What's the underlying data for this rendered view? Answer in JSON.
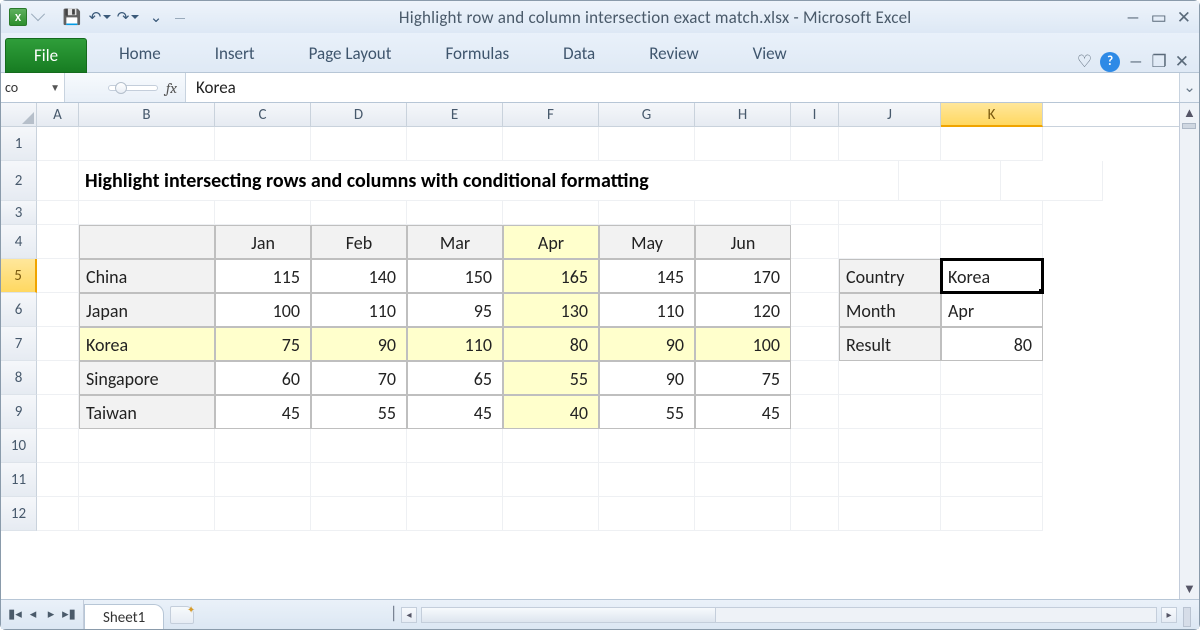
{
  "window": {
    "title": "Highlight row and column intersection exact match.xlsx - Microsoft Excel"
  },
  "ribbon": {
    "file": "File",
    "tabs": [
      "Home",
      "Insert",
      "Page Layout",
      "Formulas",
      "Data",
      "Review",
      "View"
    ]
  },
  "name_box": "co",
  "formula": "Korea",
  "columns": [
    "A",
    "B",
    "C",
    "D",
    "E",
    "F",
    "G",
    "H",
    "I",
    "J",
    "K"
  ],
  "rows_shown": [
    "1",
    "2",
    "3",
    "4",
    "5",
    "6",
    "7",
    "8",
    "9",
    "10",
    "11",
    "12"
  ],
  "selected_col": "K",
  "selected_row": "5",
  "heading": "Highlight intersecting rows and columns with conditional formatting",
  "chart_data": {
    "type": "table",
    "title": "Highlight intersecting rows and columns with conditional formatting",
    "columns": [
      "Jan",
      "Feb",
      "Mar",
      "Apr",
      "May",
      "Jun"
    ],
    "rows": [
      "China",
      "Japan",
      "Korea",
      "Singapore",
      "Taiwan"
    ],
    "values": [
      [
        115,
        140,
        150,
        165,
        145,
        170
      ],
      [
        100,
        110,
        95,
        130,
        110,
        120
      ],
      [
        75,
        90,
        110,
        80,
        90,
        100
      ],
      [
        60,
        70,
        65,
        55,
        90,
        75
      ],
      [
        45,
        55,
        45,
        40,
        55,
        45
      ]
    ],
    "highlight_row": "Korea",
    "highlight_col": "Apr",
    "lookup": {
      "labels": {
        "country": "Country",
        "month": "Month",
        "result": "Result"
      },
      "country": "Korea",
      "month": "Apr",
      "result": 80
    }
  },
  "sheet_tabs": {
    "active": "Sheet1"
  }
}
